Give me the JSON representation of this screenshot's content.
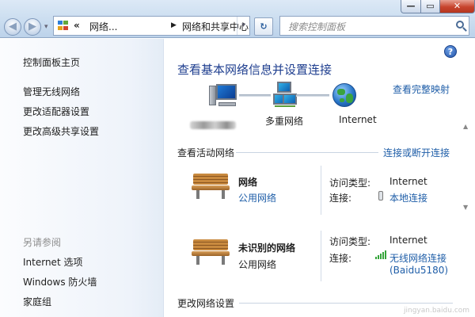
{
  "window": {
    "min_glyph": "—",
    "max_glyph": "▭",
    "close_glyph": "✕"
  },
  "nav": {
    "back_glyph": "◀",
    "forward_glyph": "▶",
    "history_glyph": "▾"
  },
  "address": {
    "overflow_glyph": "«",
    "crumb_1": "网络...",
    "separator_glyph": "▶",
    "crumb_2": "网络和共享中心",
    "dropdown_glyph": "▾"
  },
  "refresh_glyph": "↻",
  "search": {
    "placeholder": "搜索控制面板"
  },
  "sidebar": {
    "home": "控制面板主页",
    "manage_wireless": "管理无线网络",
    "change_adapter": "更改适配器设置",
    "change_sharing": "更改高级共享设置",
    "see_also": "另请参阅",
    "internet_options": "Internet 选项",
    "firewall": "Windows 防火墙",
    "homegroup": "家庭组"
  },
  "main": {
    "help_glyph": "?",
    "title": "查看基本网络信息并设置连接",
    "full_map": "查看完整映射",
    "map": {
      "multi_network": "多重网络",
      "internet": "Internet"
    },
    "active_networks": "查看活动网络",
    "connect_disconnect": "连接或断开连接",
    "networks": [
      {
        "name": "网络",
        "type": "公用网络",
        "access_label": "访问类型:",
        "access_value": "Internet",
        "conn_label": "连接:",
        "conn_value": "本地连接"
      },
      {
        "name": "未识别的网络",
        "type": "公用网络",
        "access_label": "访问类型:",
        "access_value": "Internet",
        "conn_label": "连接:",
        "conn_value": "无线网络连接",
        "conn_value_2": "(Baidu5180)"
      }
    ],
    "change_settings": "更改网络设置",
    "scroll_up": "▲",
    "scroll_down": "▼"
  },
  "watermark": "jingyan.baidu.com",
  "colors": {
    "link": "#1f5ea8",
    "title": "#1e3e8f",
    "signal": "#35a53a"
  }
}
